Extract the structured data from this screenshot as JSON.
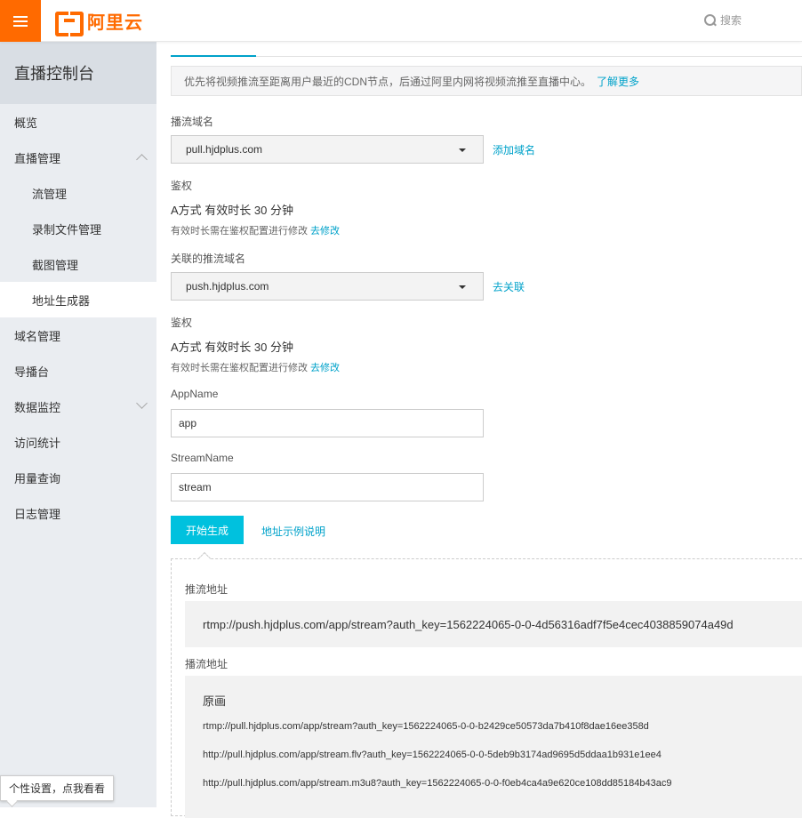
{
  "header": {
    "logo_text": "阿里云",
    "search_placeholder": "搜索"
  },
  "sidebar": {
    "title": "直播控制台",
    "items": [
      {
        "label": "概览"
      },
      {
        "label": "直播管理"
      },
      {
        "label": "流管理"
      },
      {
        "label": "录制文件管理"
      },
      {
        "label": "截图管理"
      },
      {
        "label": "地址生成器"
      },
      {
        "label": "域名管理"
      },
      {
        "label": "导播台"
      },
      {
        "label": "数据监控"
      },
      {
        "label": "访问统计"
      },
      {
        "label": "用量查询"
      },
      {
        "label": "日志管理"
      }
    ],
    "personal_tip": "个性设置，点我看看"
  },
  "main": {
    "notice_text": "优先将视频推流至距离用户最近的CDN节点，后通过阿里内网将视频流推至直播中心。",
    "notice_link": "了解更多",
    "play_domain_label": "播流域名",
    "play_domain_value": "pull.hjdplus.com",
    "add_domain_link": "添加域名",
    "auth_label_1": "鉴权",
    "auth_main_1": "A方式 有效时长 30 分钟",
    "auth_sub_1": "有效时长需在鉴权配置进行修改",
    "auth_modify_1": "去修改",
    "push_domain_label": "关联的推流域名",
    "push_domain_value": "push.hjdplus.com",
    "unlink_link": "去关联",
    "auth_label_2": "鉴权",
    "auth_main_2": "A方式 有效时长 30 分钟",
    "auth_sub_2": "有效时长需在鉴权配置进行修改",
    "auth_modify_2": "去修改",
    "appname_label": "AppName",
    "appname_value": "app",
    "streamname_label": "StreamName",
    "streamname_value": "stream",
    "generate_button": "开始生成",
    "example_link": "地址示例说明"
  },
  "result": {
    "push_label": "推流地址",
    "push_url": "rtmp://push.hjdplus.com/app/stream?auth_key=1562224065-0-0-4d56316adf7f5e4cec4038859074a49d",
    "pull_label": "播流地址",
    "pull_title": "原画",
    "pull_urls": [
      "rtmp://pull.hjdplus.com/app/stream?auth_key=1562224065-0-0-b2429ce50573da7b410f8dae16ee358d",
      "http://pull.hjdplus.com/app/stream.flv?auth_key=1562224065-0-0-5deb9b3174ad9695d5ddaa1b931e1ee4",
      "http://pull.hjdplus.com/app/stream.m3u8?auth_key=1562224065-0-0-f0eb4ca4a9e620ce108dd85184b43ac9"
    ]
  },
  "colors": {
    "brand": "#ff6a00",
    "accent": "#00c1de",
    "link": "#00a2ca"
  }
}
